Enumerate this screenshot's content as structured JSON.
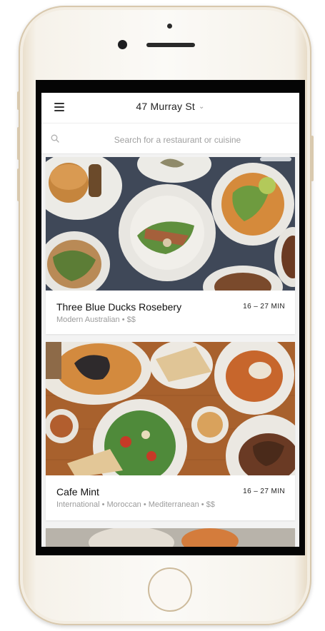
{
  "header": {
    "location": "47 Murray St"
  },
  "search": {
    "placeholder": "Search for a restaurant or cuisine"
  },
  "restaurants": [
    {
      "name": "Three Blue Ducks Rosebery",
      "tags": "Modern Australian • $$",
      "delivery_time": "16 – 27 MIN"
    },
    {
      "name": "Cafe Mint",
      "tags": "International • Moroccan • Mediterranean • $$",
      "delivery_time": "16 – 27 MIN"
    }
  ],
  "colors": {
    "app_background": "#f3f3f3",
    "card_background": "#ffffff",
    "table_slate": "#3d4452",
    "table_wood": "#a8612d"
  }
}
